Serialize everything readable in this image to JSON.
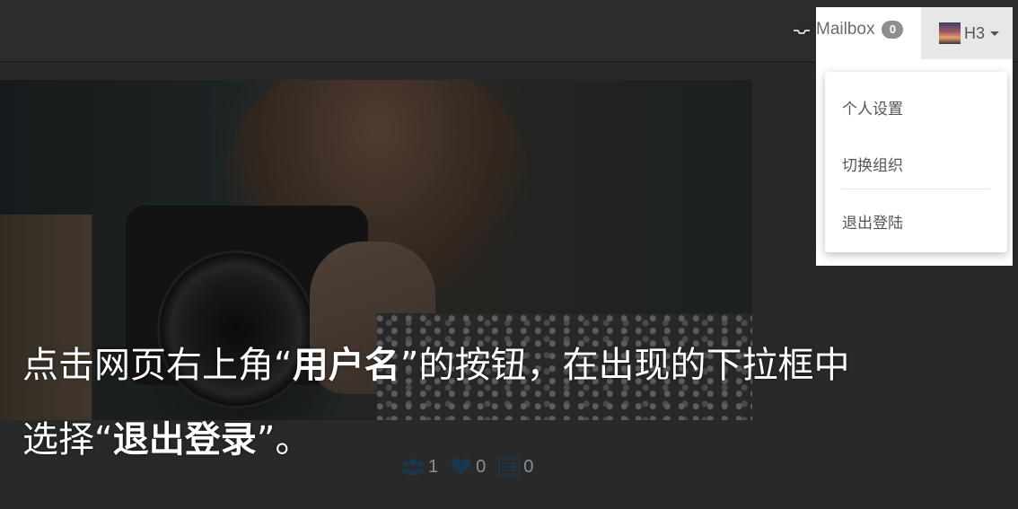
{
  "navbar": {
    "mailbox_label": "Mailbox",
    "mailbox_count": "0",
    "user_name": "H3"
  },
  "dropdown": {
    "items": [
      {
        "label": "个人设置"
      },
      {
        "label": "切换组织"
      },
      {
        "label": "退出登陆"
      }
    ]
  },
  "stats": {
    "followers": "1",
    "likes": "0",
    "posts": "0"
  },
  "caption": {
    "line1_prefix": "点击网页右上角“",
    "line1_bold": "用户名",
    "line1_suffix": "”的按钮，在出现的下拉框中",
    "line2_prefix": "选择“",
    "line2_bold": "退出登录",
    "line2_suffix": "”。"
  },
  "icons": {
    "mailbox": "inbox-icon",
    "followers": "users-icon",
    "likes": "heart-icon",
    "posts": "list-icon"
  },
  "colors": {
    "stat_icon": "#1d3f58",
    "badge": "#8e8e8e",
    "user_button_bg": "#e7e7e7"
  }
}
